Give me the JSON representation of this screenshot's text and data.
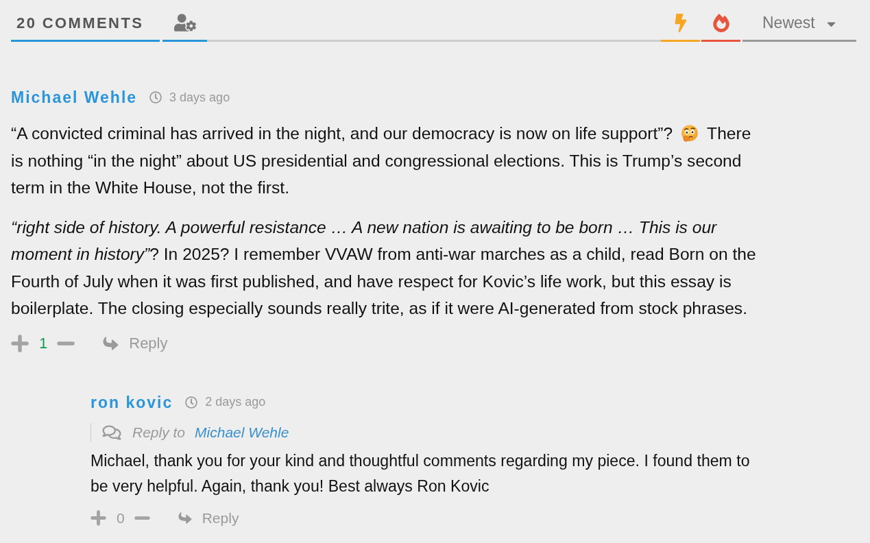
{
  "header": {
    "comment_count": "20 COMMENTS",
    "sort_options": [
      {
        "kind": "bolt",
        "color": "#f5a623"
      },
      {
        "kind": "fire",
        "color": "#e8553e"
      }
    ],
    "sort": "Newest"
  },
  "comments": [
    {
      "author": "Michael Wehle",
      "time": "3 days ago",
      "paragraphs": [
        {
          "segments": [
            {
              "kind": "text",
              "text": "“A convicted criminal has arrived in the night, and our democracy is now on life support”?"
            },
            {
              "kind": "emoji"
            },
            {
              "kind": "text",
              "text": "There is nothing “in the night” about US presidential and congressional elections. This is Trump’s second term in the White House, not the first."
            }
          ]
        },
        {
          "segments": [
            {
              "kind": "text",
              "text": "*“right side of history. A powerful resistance … A new nation is awaiting to be born … This is our moment in history”*? In 2025? I remember VVAW from anti-war marches as a child, read Born on the Fourth of July when it was first published, and have respect for Kovic’s life work, but this essay is boilerplate. The closing especially sounds really trite, as if it were AI-generated from stock phrases."
            }
          ]
        }
      ],
      "votes": "1",
      "positive": true,
      "reply_label": "Reply",
      "children": [
        {
          "author": "ron kovic",
          "time": "2 days ago",
          "reply_to": {
            "label": "Reply to",
            "name": "Michael Wehle"
          },
          "paragraphs": [
            {
              "segments": [
                {
                  "kind": "text",
                  "text": "Michael, thank you for your kind and thoughtful comments regarding my piece. I found them to be very helpful. Again, thank you! Best always Ron Kovic"
                }
              ]
            }
          ],
          "votes": "0",
          "positive": false,
          "reply_label": "Reply"
        }
      ]
    }
  ]
}
